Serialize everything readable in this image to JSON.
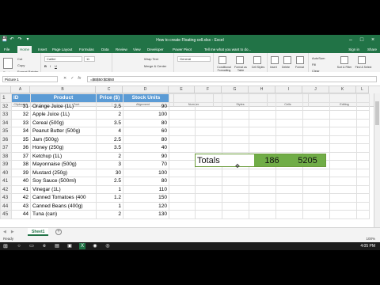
{
  "window": {
    "title": "How to create Floating cell.xlsx - Excel",
    "min": "–",
    "max": "□",
    "close": "×",
    "quick_access": [
      "💾",
      "↶",
      "↷",
      "▾"
    ]
  },
  "tabs": [
    "File",
    "Home",
    "Insert",
    "Page Layout",
    "Formulas",
    "Data",
    "Review",
    "View",
    "Developer",
    "Power Pivot"
  ],
  "tell_me": "Tell me what you want to do...",
  "sign_in": "Sign in",
  "share": "Share",
  "ribbon": {
    "clipboard": {
      "paste": "Paste",
      "cut": "Cut",
      "copy": "Copy",
      "format_painter": "Format Painter",
      "label": "Clipboard"
    },
    "font": {
      "name": "Calibri",
      "size": "11",
      "label": "Font"
    },
    "alignment": {
      "wrap": "Wrap Text",
      "merge": "Merge & Center",
      "label": "Alignment"
    },
    "number": {
      "format": "General",
      "label": "Number"
    },
    "styles": {
      "cond": "Conditional Formatting",
      "table": "Format as Table",
      "cell": "Cell Styles",
      "label": "Styles"
    },
    "cells": {
      "insert": "Insert",
      "delete": "Delete",
      "format": "Format",
      "label": "Cells"
    },
    "editing": {
      "autosum": "AutoSum",
      "fill": "Fill",
      "clear": "Clear",
      "sort": "Sort & Filter",
      "find": "Find & Select",
      "label": "Editing"
    }
  },
  "formula_bar": {
    "name_box": "Picture 1",
    "fx": "fx",
    "formula": "=$B$50:$D$50"
  },
  "columns": [
    "",
    "A",
    "B",
    "C",
    "D",
    "E",
    "F",
    "G",
    "H",
    "I",
    "J",
    "K",
    "L"
  ],
  "header_row": {
    "num": "1",
    "id": "ID",
    "product": "Product",
    "price": "Price ($)",
    "units": "Stock Units"
  },
  "rows": [
    {
      "r": "32",
      "id": "31",
      "p": "Orange Juice (1L)",
      "price": "2.5",
      "u": "90"
    },
    {
      "r": "33",
      "id": "32",
      "p": "Apple Juice (1L)",
      "price": "2",
      "u": "100"
    },
    {
      "r": "34",
      "id": "33",
      "p": "Cereal (500g)",
      "price": "3.5",
      "u": "80"
    },
    {
      "r": "35",
      "id": "34",
      "p": "Peanut Butter (500g)",
      "price": "4",
      "u": "60"
    },
    {
      "r": "36",
      "id": "35",
      "p": "Jam (500g)",
      "price": "2.5",
      "u": "80"
    },
    {
      "r": "37",
      "id": "36",
      "p": "Honey (250g)",
      "price": "3.5",
      "u": "40"
    },
    {
      "r": "38",
      "id": "37",
      "p": "Ketchup (1L)",
      "price": "2",
      "u": "90"
    },
    {
      "r": "39",
      "id": "38",
      "p": "Mayonnaise (500g)",
      "price": "3",
      "u": "70"
    },
    {
      "r": "40",
      "id": "39",
      "p": "Mustard (250g)",
      "price": "30",
      "u": "100"
    },
    {
      "r": "41",
      "id": "40",
      "p": "Soy Sauce (500ml)",
      "price": "2.5",
      "u": "80"
    },
    {
      "r": "42",
      "id": "41",
      "p": "Vinegar (1L)",
      "price": "1",
      "u": "110"
    },
    {
      "r": "43",
      "id": "42",
      "p": "Canned Tomatoes (400",
      "price": "1.2",
      "u": "150"
    },
    {
      "r": "44",
      "id": "43",
      "p": "Canned Beans (400g)",
      "price": "1",
      "u": "120"
    },
    {
      "r": "45",
      "id": "44",
      "p": "Tuna (can)",
      "price": "2",
      "u": "130"
    }
  ],
  "floating": {
    "label": "Totals",
    "v1": "186",
    "v2": "5205"
  },
  "sheet_tab": "Sheet1",
  "add_sheet": "+",
  "status": "Ready",
  "zoom": "100%",
  "taskbar_time": "4:05 PM"
}
